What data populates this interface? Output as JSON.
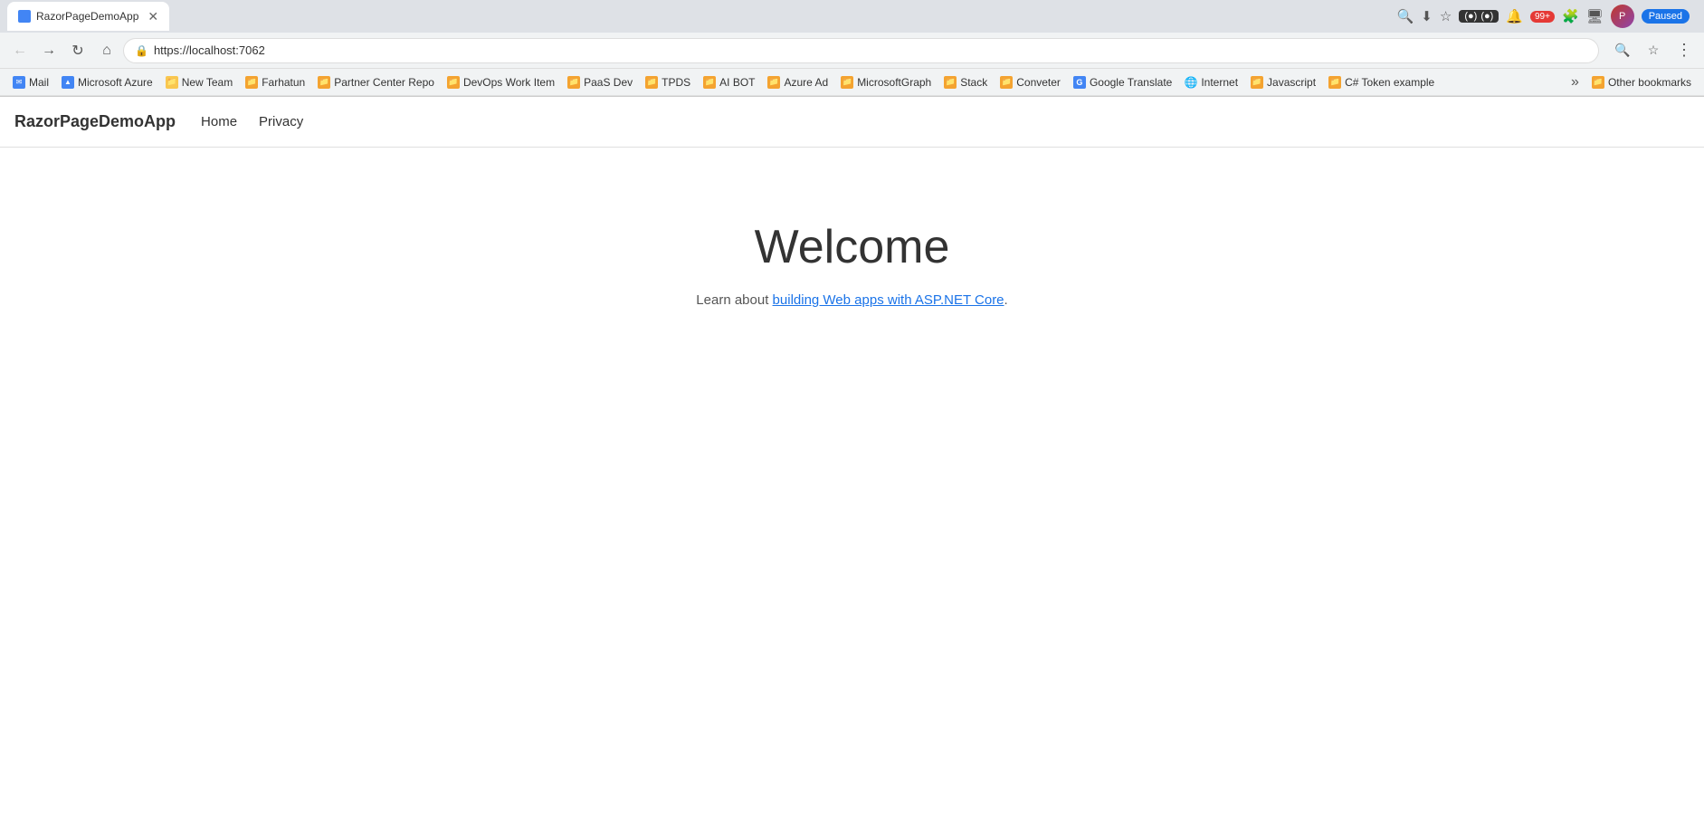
{
  "browser": {
    "tab": {
      "title": "RazorPageDemoApp",
      "favicon_color": "#4285f4"
    },
    "address": "https://localhost:7062",
    "paused_label": "Paused"
  },
  "bookmarks": [
    {
      "id": "mail",
      "label": "Mail",
      "color": "bm-blue",
      "icon": "✉"
    },
    {
      "id": "microsoft-azure",
      "label": "Microsoft Azure",
      "color": "bm-blue",
      "icon": "⬡"
    },
    {
      "id": "new-team",
      "label": "New Team",
      "color": "bm-yellow",
      "icon": "📁"
    },
    {
      "id": "farhatun",
      "label": "Farhatun",
      "color": "bm-orange",
      "icon": "📁"
    },
    {
      "id": "partner-center-repo",
      "label": "Partner Center Repo",
      "color": "bm-orange",
      "icon": "📁"
    },
    {
      "id": "devops-work-item",
      "label": "DevOps Work Item",
      "color": "bm-orange",
      "icon": "📁"
    },
    {
      "id": "paas-dev",
      "label": "PaaS Dev",
      "color": "bm-orange",
      "icon": "📁"
    },
    {
      "id": "tpds",
      "label": "TPDS",
      "color": "bm-orange",
      "icon": "📁"
    },
    {
      "id": "ai-bot",
      "label": "AI BOT",
      "color": "bm-orange",
      "icon": "📁"
    },
    {
      "id": "azure-ad",
      "label": "Azure Ad",
      "color": "bm-orange",
      "icon": "📁"
    },
    {
      "id": "microsoftgraph",
      "label": "MicrosoftGraph",
      "color": "bm-orange",
      "icon": "📁"
    },
    {
      "id": "stack",
      "label": "Stack",
      "color": "bm-orange",
      "icon": "📁"
    },
    {
      "id": "conveter",
      "label": "Conveter",
      "color": "bm-orange",
      "icon": "📁"
    },
    {
      "id": "google-translate",
      "label": "Google Translate",
      "color": "bm-teal",
      "icon": "G"
    },
    {
      "id": "internet",
      "label": "Internet",
      "color": "bm-chrome",
      "icon": "🌐"
    },
    {
      "id": "javascript",
      "label": "Javascript",
      "color": "bm-orange",
      "icon": "📁"
    },
    {
      "id": "csharp-token",
      "label": "C# Token example",
      "color": "bm-orange",
      "icon": "📁"
    }
  ],
  "other_bookmarks_label": "Other bookmarks",
  "app": {
    "brand": "RazorPageDemoApp",
    "nav": [
      {
        "id": "home",
        "label": "Home"
      },
      {
        "id": "privacy",
        "label": "Privacy"
      }
    ],
    "welcome_title": "Welcome",
    "welcome_subtitle_before": "Learn about ",
    "welcome_link_text": "building Web apps with ASP.NET Core",
    "welcome_subtitle_after": ".",
    "welcome_link_href": "#"
  }
}
